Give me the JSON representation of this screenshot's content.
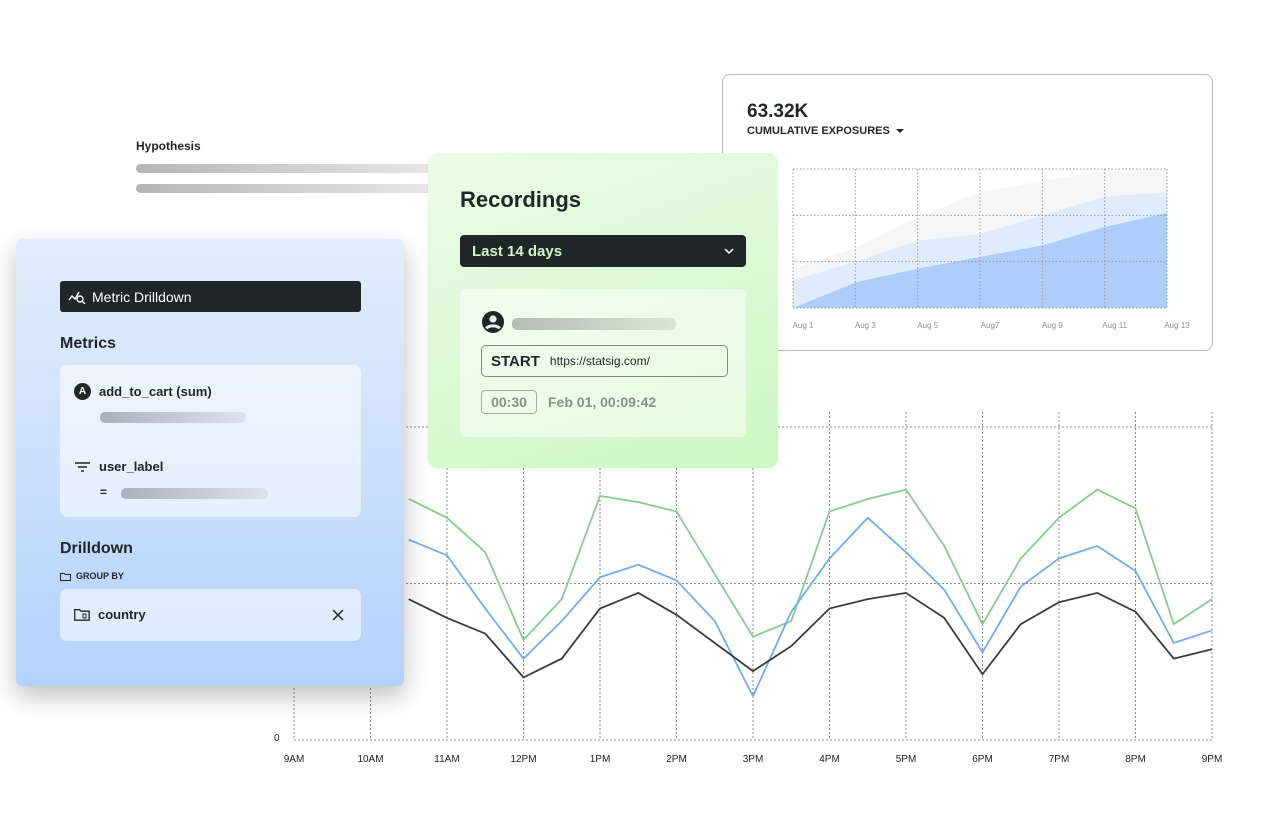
{
  "hypothesis": {
    "label": "Hypothesis"
  },
  "exposures": {
    "value": "63.32K",
    "label": "CUMULATIVE EXPOSURES",
    "dropdown_icon": "caret-down-icon"
  },
  "recordings": {
    "title": "Recordings",
    "range": "Last 14 days",
    "start_label": "START",
    "url": "https://statsig.com/",
    "duration": "00:30",
    "timestamp": "Feb 01, 00:09:42"
  },
  "drilldown_panel": {
    "header": "Metric Drilldown",
    "metrics_title": "Metrics",
    "metric_badge": "A",
    "metric": "add_to_cart (sum)",
    "filter_field": "user_label",
    "filter_op": "=",
    "drilldown_title": "Drilldown",
    "group_by_label": "GROUP BY",
    "group_value": "country"
  },
  "chart_data": [
    {
      "type": "area",
      "stacked": false,
      "categories": [
        "Aug 1",
        "Aug 3",
        "Aug 5",
        "Aug7",
        "Aug 9",
        "Aug 11",
        "Aug 13"
      ],
      "ylim": [
        0,
        3
      ],
      "grid": true,
      "series": [
        {
          "color": "#f6f6f6",
          "values": [
            0.85,
            1.3,
            1.95,
            2.5,
            2.75,
            2.95,
            3.0
          ]
        },
        {
          "color": "#e0ecfc",
          "values": [
            0.6,
            1.0,
            1.45,
            1.6,
            2.0,
            2.4,
            2.5
          ]
        },
        {
          "color": "#aecdfb",
          "values": [
            0,
            0.55,
            0.85,
            1.1,
            1.35,
            1.75,
            2.05
          ]
        }
      ]
    },
    {
      "type": "line",
      "x_ticks": [
        "9AM",
        "10AM",
        "11AM",
        "12PM",
        "1PM",
        "2PM",
        "3PM",
        "4PM",
        "5PM",
        "6PM",
        "7PM",
        "8PM",
        "9PM"
      ],
      "y_ticks": [
        "0"
      ],
      "ylim": [
        0,
        100
      ],
      "grid": true,
      "x": [
        "10:30",
        "11:00",
        "11:30",
        "12:00",
        "12:30",
        "13:00",
        "13:30",
        "14:00",
        "14:30",
        "15:00",
        "15:30",
        "16:00",
        "16:30",
        "17:00",
        "17:30",
        "18:00",
        "18:30",
        "19:00",
        "19:30",
        "20:00",
        "20:30",
        "21:00"
      ],
      "series": [
        {
          "color": "#86cc8f",
          "values": [
            77,
            71,
            60,
            32,
            45,
            78,
            76,
            73,
            53,
            33,
            38,
            73,
            77,
            80,
            62,
            37,
            58,
            71,
            80,
            74,
            37,
            45
          ]
        },
        {
          "color": "#72aaf8",
          "values": [
            64,
            59,
            42,
            26,
            38,
            52,
            56,
            51,
            38,
            14,
            41,
            58,
            71,
            60,
            48,
            28,
            49,
            58,
            62,
            54,
            31,
            35
          ]
        },
        {
          "color": "#3a3d3f",
          "values": [
            45,
            39,
            34,
            20,
            26,
            42,
            47,
            40,
            31,
            22,
            30,
            42,
            45,
            47,
            39,
            21,
            37,
            44,
            47,
            41,
            26,
            29
          ]
        }
      ]
    }
  ]
}
